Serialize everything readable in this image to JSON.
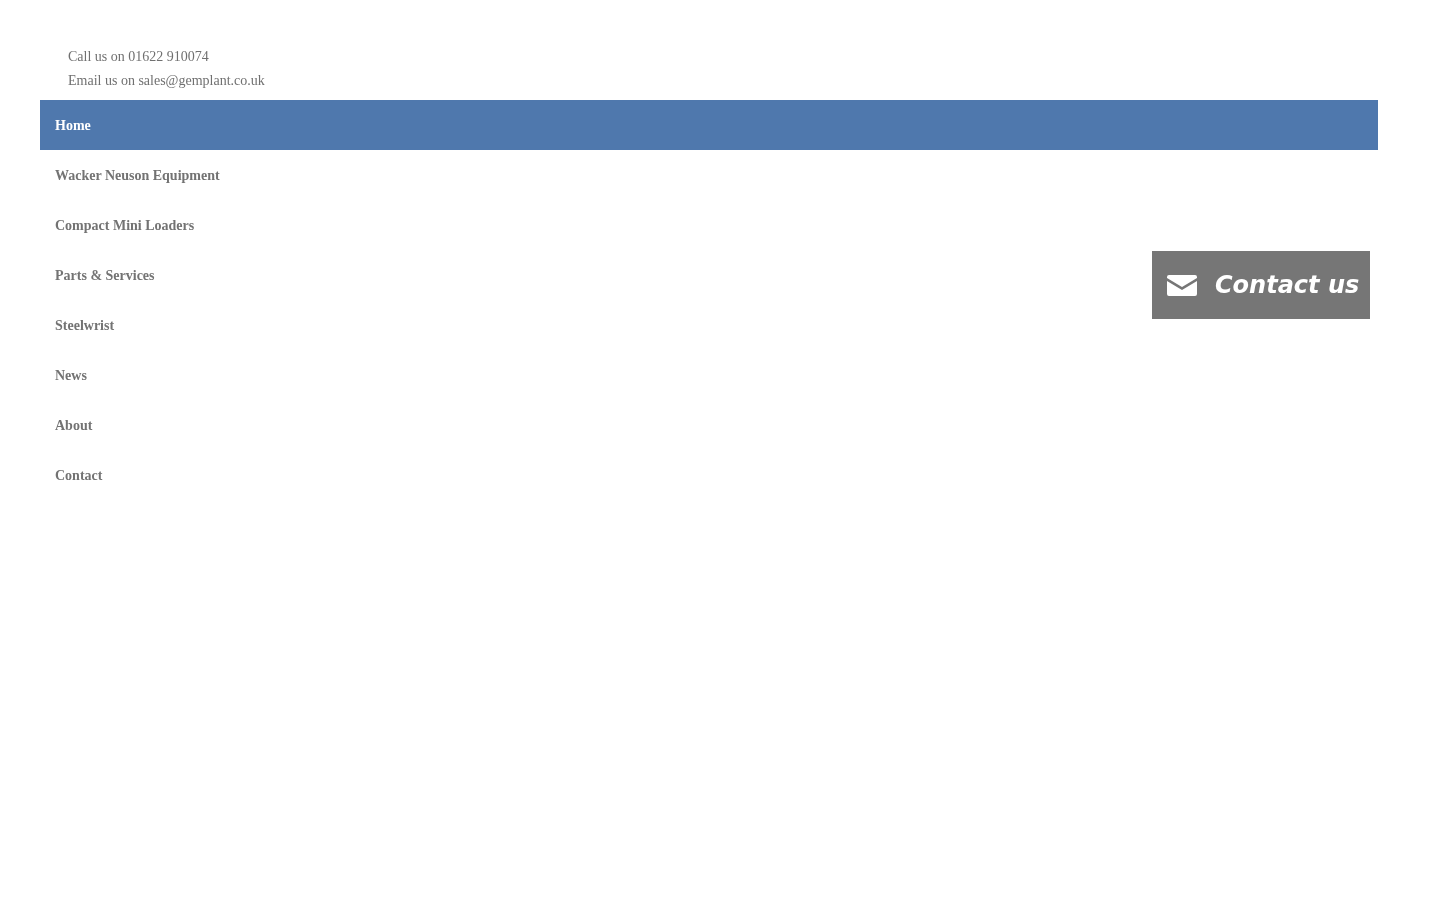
{
  "contact_lines": [
    "Call us on 01622 910074",
    "Email us on sales@gemplant.co.uk"
  ],
  "nav": [
    {
      "label": "Home",
      "selected": true
    },
    {
      "label": "Wacker Neuson Equipment",
      "selected": false
    },
    {
      "label": "Compact Mini Loaders",
      "selected": false
    },
    {
      "label": "Parts & Services",
      "selected": false
    },
    {
      "label": "Steelwrist",
      "selected": false
    },
    {
      "label": "News",
      "selected": false
    },
    {
      "label": "About",
      "selected": false
    },
    {
      "label": "Contact",
      "selected": false
    }
  ],
  "contact_button": {
    "label": "Contact us"
  }
}
